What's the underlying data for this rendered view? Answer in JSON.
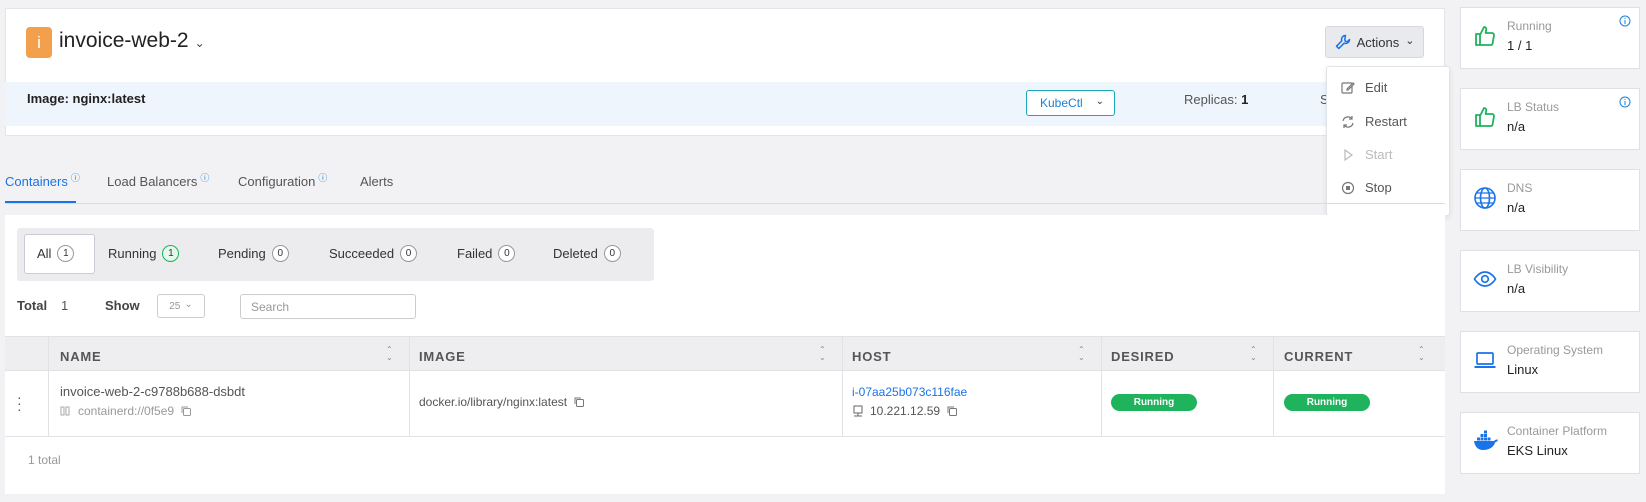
{
  "header": {
    "avatar_letter": "i",
    "title": "invoice-web-2",
    "actions_label": "Actions",
    "image_label": "Image: nginx:latest",
    "kubectl_label": "KubeCtl",
    "replicas_label": "Replicas:",
    "replicas_value": "1",
    "status_fragment": "S"
  },
  "actions_menu": {
    "items": [
      {
        "label": "Edit",
        "icon": "edit-icon",
        "enabled": true
      },
      {
        "label": "Restart",
        "icon": "restart-icon",
        "enabled": true
      },
      {
        "label": "Start",
        "icon": "play-icon",
        "enabled": false
      },
      {
        "label": "Stop",
        "icon": "stop-icon",
        "enabled": true
      }
    ]
  },
  "tabs": [
    {
      "label": "Containers",
      "info": true,
      "active": true
    },
    {
      "label": "Load Balancers",
      "info": true,
      "active": false
    },
    {
      "label": "Configuration",
      "info": true,
      "active": false
    },
    {
      "label": "Alerts",
      "info": false,
      "active": false
    }
  ],
  "filters": [
    {
      "label": "All",
      "count": "1",
      "selected": true
    },
    {
      "label": "Running",
      "count": "1",
      "selected": false
    },
    {
      "label": "Pending",
      "count": "0",
      "selected": false
    },
    {
      "label": "Succeeded",
      "count": "0",
      "selected": false
    },
    {
      "label": "Failed",
      "count": "0",
      "selected": false
    },
    {
      "label": "Deleted",
      "count": "0",
      "selected": false
    }
  ],
  "toolbar": {
    "total_label": "Total",
    "total_value": "1",
    "show_label": "Show",
    "page_size": "25",
    "search_placeholder": "Search"
  },
  "table": {
    "columns": [
      "NAME",
      "IMAGE",
      "HOST",
      "DESIRED",
      "CURRENT"
    ],
    "rows": [
      {
        "name": "invoice-web-2-c9788b688-dsbdt",
        "runtime": "containerd://0f5e9",
        "image": "docker.io/library/nginx:latest",
        "host_id": "i-07aa25b073c116fae",
        "host_ip": "10.221.12.59",
        "desired": "Running",
        "current": "Running"
      }
    ],
    "footer": "1 total"
  },
  "stats": [
    {
      "label": "Running",
      "value": "1 / 1",
      "icon": "thumbs-up-icon",
      "info": true
    },
    {
      "label": "LB Status",
      "value": "n/a",
      "icon": "thumbs-up-icon",
      "info": true
    },
    {
      "label": "DNS",
      "value": "n/a",
      "icon": "globe-icon",
      "info": false
    },
    {
      "label": "LB Visibility",
      "value": "n/a",
      "icon": "eye-icon",
      "info": false
    },
    {
      "label": "Operating System",
      "value": "Linux",
      "icon": "laptop-icon",
      "info": false
    },
    {
      "label": "Container Platform",
      "value": "EKS Linux",
      "icon": "docker-icon",
      "info": false
    }
  ],
  "colors": {
    "accent": "#1a73e8",
    "success": "#1eb35c",
    "avatar": "#f2a04b",
    "info_band": "#eef5fd"
  }
}
